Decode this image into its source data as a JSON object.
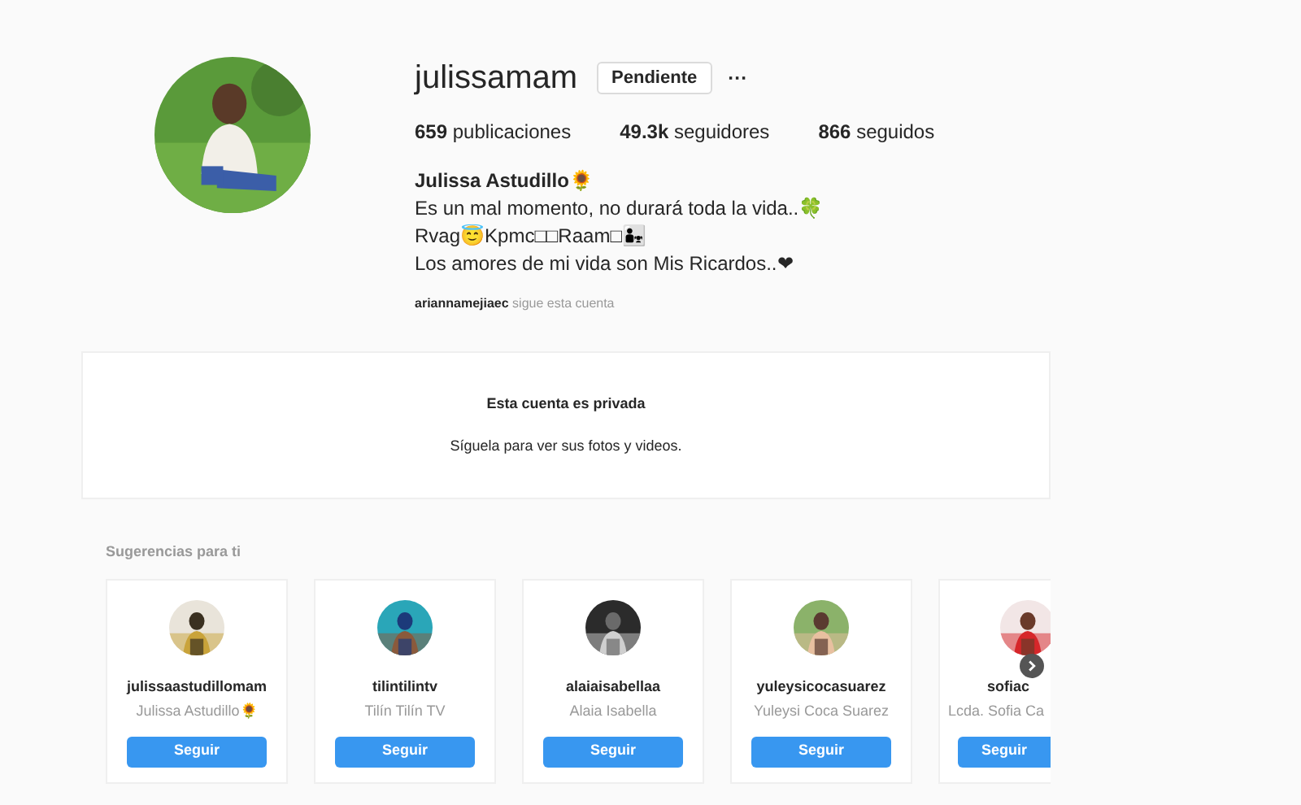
{
  "profile": {
    "username": "julissamam",
    "follow_button": "Pendiente",
    "more": "···",
    "stats": [
      {
        "count": "659",
        "label": "publicaciones"
      },
      {
        "count": "49.3k",
        "label": "seguidores"
      },
      {
        "count": "866",
        "label": "seguidos"
      }
    ],
    "full_name": "Julissa Astudillo🌻",
    "bio": [
      "Es un mal momento, no durará toda la vida..🍀",
      "Rvag😇Kpmc□□Raam□👨‍👧",
      "Los amores de mi vida son Mis Ricardos..❤"
    ],
    "followed_by": {
      "user": "ariannamejiaec",
      "text": "sigue esta cuenta"
    }
  },
  "private_notice": {
    "title": "Esta cuenta es privada",
    "text": "Síguela para ver sus fotos y videos."
  },
  "suggestions": {
    "title": "Sugerencias para ti",
    "cards": [
      {
        "username": "julissaastudillomam",
        "name": "Julissa Astudillo🌻",
        "button": "Seguir"
      },
      {
        "username": "tilintilintv",
        "name": "Tilín Tilín TV",
        "button": "Seguir"
      },
      {
        "username": "alaiaisabellaa",
        "name": "Alaia Isabella",
        "button": "Seguir"
      },
      {
        "username": "yuleysicocasuarez",
        "name": "Yuleysi Coca Suarez",
        "button": "Seguir"
      },
      {
        "username": "sofiac",
        "name": "Lcda. Sofia Ca",
        "button": "Seguir"
      }
    ]
  }
}
